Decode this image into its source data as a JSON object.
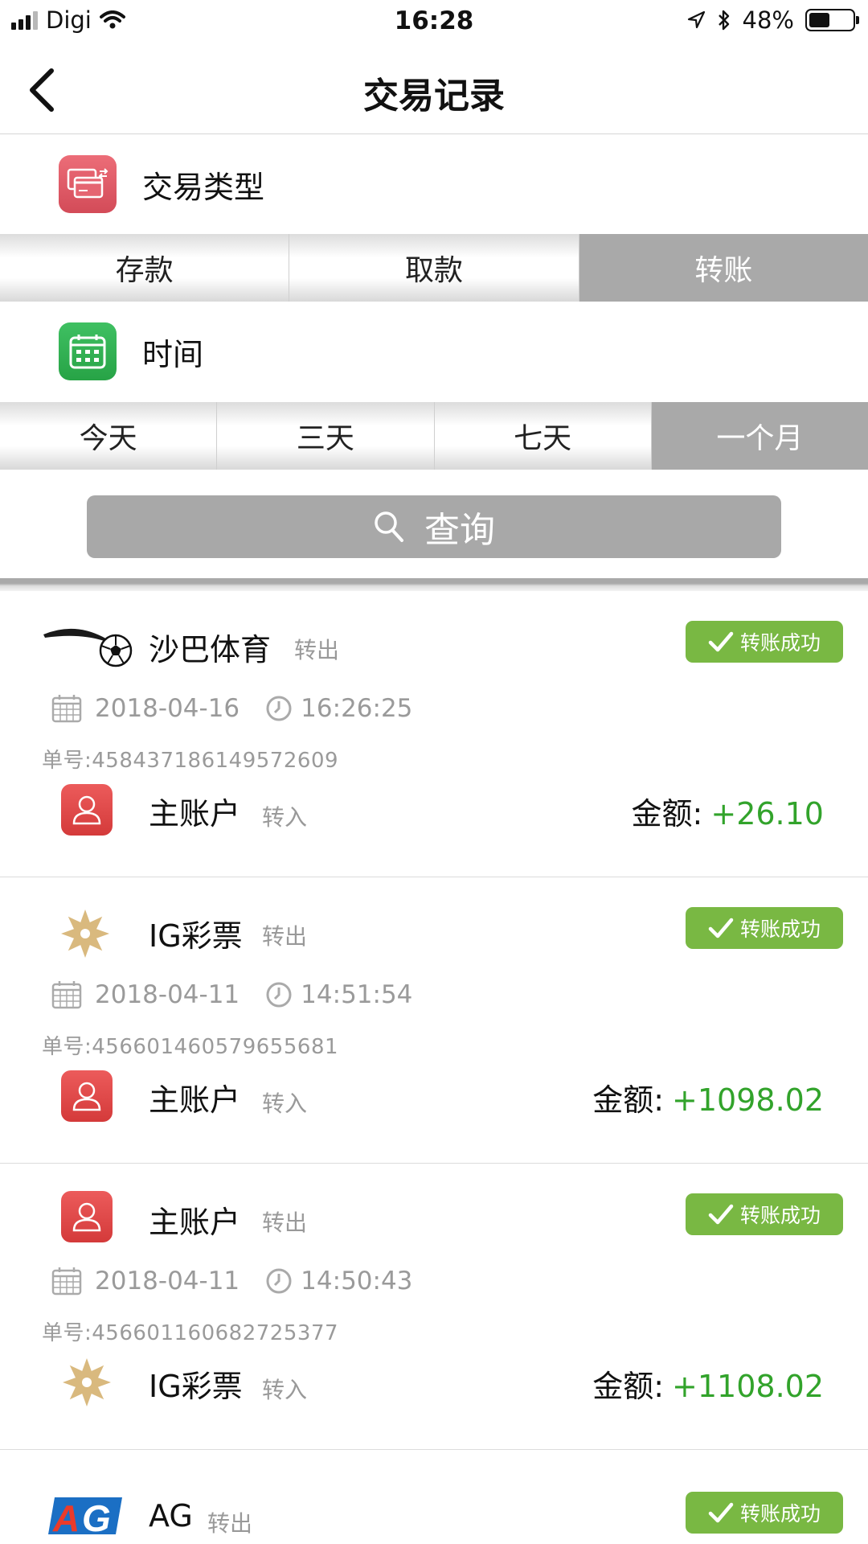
{
  "status_bar": {
    "carrier": "Digi",
    "time": "16:28",
    "battery": "48%",
    "battery_level": 0.48
  },
  "nav": {
    "title": "交易记录"
  },
  "filters": {
    "type_label": "交易类型",
    "type_options": [
      "存款",
      "取款",
      "转账"
    ],
    "type_selected": "转账",
    "time_label": "时间",
    "time_options": [
      "今天",
      "三天",
      "七天",
      "一个月"
    ],
    "time_selected": "一个月",
    "query_label": "查询"
  },
  "order_prefix": "单号:",
  "amount_prefix": "金额:",
  "records": [
    {
      "from_name": "沙巴体育",
      "from_dir": "转出",
      "from_icon": "soccer-ball-icon",
      "status": "转账成功",
      "date": "2018-04-16",
      "time": "16:26:25",
      "order_no": "458437186149572609",
      "to_name": "主账户",
      "to_dir": "转入",
      "to_icon": "user-icon",
      "amount": "+26.10"
    },
    {
      "from_name": "IG彩票",
      "from_dir": "转出",
      "from_icon": "ig-lottery-icon",
      "status": "转账成功",
      "date": "2018-04-11",
      "time": "14:51:54",
      "order_no": "456601460579655681",
      "to_name": "主账户",
      "to_dir": "转入",
      "to_icon": "user-icon",
      "amount": "+1098.02"
    },
    {
      "from_name": "主账户",
      "from_dir": "转出",
      "from_icon": "user-icon",
      "status": "转账成功",
      "date": "2018-04-11",
      "time": "14:50:43",
      "order_no": "456601160682725377",
      "to_name": "IG彩票",
      "to_dir": "转入",
      "to_icon": "ig-lottery-icon",
      "amount": "+1108.02"
    },
    {
      "from_name": "AG",
      "from_dir": "转出",
      "from_icon": "ag-logo-icon",
      "status": "转账成功"
    }
  ],
  "colors": {
    "success_badge": "#79b843",
    "amount": "#32a32b",
    "selected_segment": "#a9a9a9",
    "query_button": "#a8a8a8"
  }
}
